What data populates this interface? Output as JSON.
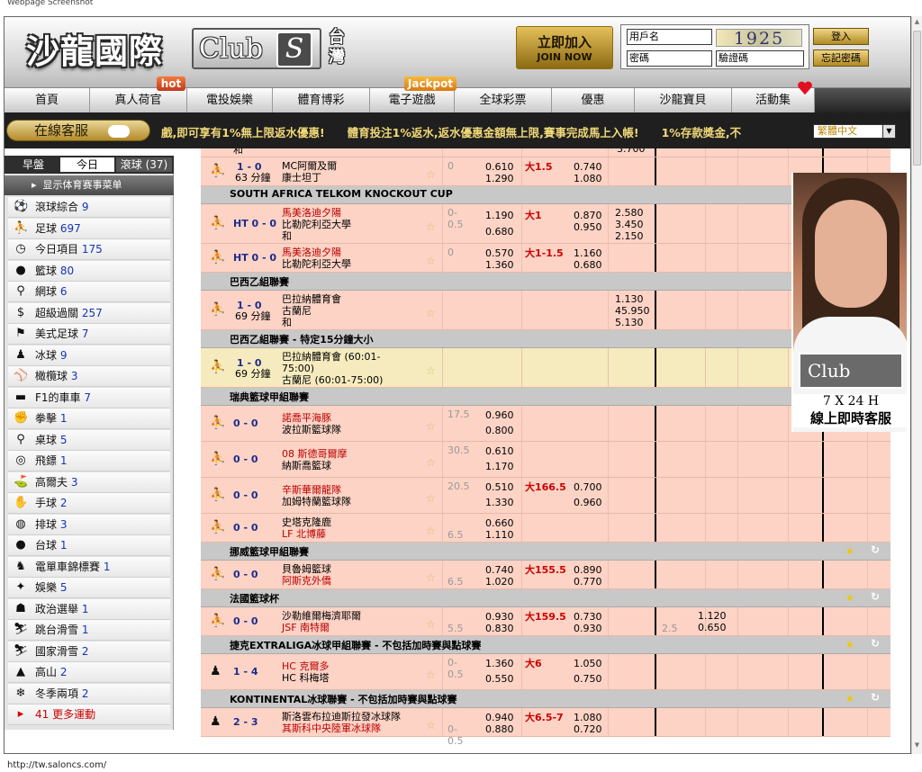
{
  "caption": "Webpage Screenshot",
  "status_url": "http://tw.saloncs.com/",
  "header": {
    "logo_text": "沙龍國際",
    "club_text": "Club",
    "club_s": "S",
    "region": "台灣",
    "join_cn": "立即加入",
    "join_en": "JOIN NOW",
    "username_placeholder": "用戶名",
    "password_placeholder": "密碼",
    "captcha_code": "1925",
    "captcha_placeholder": "驗證碼",
    "login_label": "登入",
    "forgot_label": "忘記密碼"
  },
  "badges": {
    "hot": "hot",
    "jackpot": "Jackpot"
  },
  "nav": [
    "首頁",
    "真人荷官",
    "電投娛樂",
    "體育博彩",
    "電子遊戲",
    "全球彩票",
    "優惠",
    "沙龍寶貝",
    "活動集"
  ],
  "marquee": {
    "service_label": "在線客服",
    "text": "戲,即可享有1%無上限返水優惠!　　體育投注1%返水,返水優惠金額無上限,賽事完成馬上入帳!　　1%存款獎金,不",
    "language": "繁體中文"
  },
  "sidebar": {
    "tabs": [
      "早盤",
      "今日",
      "滾球 (37)"
    ],
    "menu_header": "显示体育赛事菜单",
    "items": [
      {
        "icon": "soccer-ball-icon",
        "label": "滾球綜合",
        "count": "9"
      },
      {
        "icon": "soccer-player-icon",
        "label": "足球",
        "count": "697"
      },
      {
        "icon": "clock-icon",
        "label": "今日項目",
        "count": "175"
      },
      {
        "icon": "basketball-icon",
        "label": "籃球",
        "count": "80"
      },
      {
        "icon": "tennis-icon",
        "label": "網球",
        "count": "6"
      },
      {
        "icon": "parlay-icon",
        "label": "超級過關",
        "count": "257"
      },
      {
        "icon": "american-football-icon",
        "label": "美式足球",
        "count": "7"
      },
      {
        "icon": "ice-hockey-icon",
        "label": "冰球",
        "count": "9"
      },
      {
        "icon": "baseball-icon",
        "label": "橄欖球",
        "count": "3"
      },
      {
        "icon": "f1-car-icon",
        "label": "F1的車車",
        "count": "7"
      },
      {
        "icon": "boxing-icon",
        "label": "拳擊",
        "count": "1"
      },
      {
        "icon": "table-tennis-icon",
        "label": "桌球",
        "count": "5"
      },
      {
        "icon": "darts-icon",
        "label": "飛鏢",
        "count": "1"
      },
      {
        "icon": "golf-icon",
        "label": "高爾夫",
        "count": "3"
      },
      {
        "icon": "handball-icon",
        "label": "手球",
        "count": "2"
      },
      {
        "icon": "volleyball-icon",
        "label": "排球",
        "count": "3"
      },
      {
        "icon": "billiards-icon",
        "label": "台球",
        "count": "1"
      },
      {
        "icon": "motorbike-icon",
        "label": "電單車錦標賽",
        "count": "1"
      },
      {
        "icon": "entertainment-icon",
        "label": "娛樂",
        "count": "5"
      },
      {
        "icon": "politics-icon",
        "label": "政治選舉",
        "count": "1"
      },
      {
        "icon": "ski-jump-icon",
        "label": "跳台滑雪",
        "count": "1"
      },
      {
        "icon": "cross-country-ski-icon",
        "label": "國家滑雪",
        "count": "2"
      },
      {
        "icon": "mountain-icon",
        "label": "高山",
        "count": "2"
      },
      {
        "icon": "winter-sport-icon",
        "label": "冬季兩項",
        "count": "2"
      }
    ],
    "more": "41 更多運動"
  },
  "odds": {
    "top_partial": {
      "team": "和",
      "val": "3.700"
    },
    "rows": [
      {
        "type": "match",
        "sport": "soccer",
        "score": "1 - 0",
        "time": "63 分鐘",
        "teams": [
          "MC阿爾及爾",
          "康士坦丁"
        ],
        "red": [
          false,
          false
        ],
        "hc": "0",
        "hcodds": [
          "0.610",
          "1.290"
        ],
        "ou": "大1.5",
        "ouodds": [
          "0.740",
          "1.080"
        ],
        "x12": []
      },
      {
        "type": "section",
        "title": "SOUTH AFRICA TELKOM KNOCKOUT CUP"
      },
      {
        "type": "match",
        "sport": "soccer",
        "score": "HT 0 - 0",
        "time": "",
        "teams": [
          "馬美洛迪夕陽",
          "比勒陀利亞大學",
          "和"
        ],
        "red": [
          true,
          false,
          false
        ],
        "hc": "0-0.5",
        "hcodds": [
          "1.190",
          "0.680"
        ],
        "ou": "大1",
        "ouodds": [
          "0.870",
          "0.950"
        ],
        "x12": [
          "2.580",
          "3.450",
          "2.150"
        ]
      },
      {
        "type": "match",
        "sport": "soccer",
        "score": "HT 0 - 0",
        "time": "",
        "teams": [
          "馬美洛迪夕陽",
          "比勒陀利亞大學"
        ],
        "red": [
          true,
          false
        ],
        "hc": "0",
        "hcodds": [
          "0.570",
          "1.360"
        ],
        "ou": "大1-1.5",
        "ouodds": [
          "1.160",
          "0.680"
        ],
        "x12": []
      },
      {
        "type": "section",
        "title": "巴西乙組聯賽"
      },
      {
        "type": "match",
        "sport": "soccer",
        "score": "1 - 0",
        "time": "69 分鐘",
        "teams": [
          "巴拉納體育會",
          "古蘭尼",
          "和"
        ],
        "red": [
          false,
          false,
          false
        ],
        "hc": "",
        "hcodds": [],
        "ou": "",
        "ouodds": [],
        "x12": [
          "1.130",
          "45.950",
          "5.130"
        ]
      },
      {
        "type": "section",
        "title": "巴西乙組聯賽 - 特定15分鐘大小"
      },
      {
        "type": "match",
        "yellow": true,
        "sport": "soccer",
        "score": "1 - 0",
        "time": "69 分鐘",
        "teams": [
          "巴拉納體育會 (60:01-",
          "75:00)",
          "古蘭尼 (60:01-75:00)"
        ],
        "red": [
          false,
          false,
          false
        ],
        "hc": "",
        "hcodds": [],
        "ou": "",
        "ouodds": [],
        "x12": []
      },
      {
        "type": "section",
        "title": "瑞典籃球甲組聯賽",
        "icons": true
      },
      {
        "type": "match",
        "sport": "basketball",
        "score": "0 - 0",
        "time": "",
        "teams": [
          "諾喬平海豚",
          "波拉斯籃球隊"
        ],
        "red": [
          true,
          false
        ],
        "hc": "17.5",
        "hcodds": [
          "0.960",
          "0.800"
        ],
        "ou": "",
        "ouodds": [],
        "x12": []
      },
      {
        "type": "match",
        "sport": "basketball",
        "score": "0 - 0",
        "time": "",
        "teams": [
          "08 斯德哥爾摩",
          "納斯喬籃球"
        ],
        "red": [
          true,
          false
        ],
        "hc": "30.5",
        "hcodds": [
          "0.610",
          "1.170"
        ],
        "ou": "",
        "ouodds": [],
        "x12": []
      },
      {
        "type": "match",
        "sport": "basketball",
        "score": "0 - 0",
        "time": "",
        "teams": [
          "辛斯華爾龍隊",
          "加姆特蘭籃球隊"
        ],
        "red": [
          true,
          false
        ],
        "hc": "20.5",
        "hcodds": [
          "0.510",
          "1.330"
        ],
        "ou": "大166.5",
        "ouodds": [
          "0.700",
          "0.960"
        ],
        "x12": []
      },
      {
        "type": "match",
        "sport": "basketball",
        "score": "0 - 0",
        "time": "",
        "teams": [
          "史塔克隆鹿",
          "LF 北博藤"
        ],
        "red": [
          false,
          true
        ],
        "hc": "6.5",
        "hclow": true,
        "hcodds": [
          "0.660",
          "1.110"
        ],
        "ou": "",
        "ouodds": [],
        "x12": []
      },
      {
        "type": "section",
        "title": "挪威籃球甲組聯賽",
        "icons": true
      },
      {
        "type": "match",
        "sport": "basketball",
        "score": "0 - 0",
        "time": "",
        "teams": [
          "貝魯姆籃球",
          "阿斯克外僑"
        ],
        "red": [
          false,
          true
        ],
        "hc": "6.5",
        "hclow": true,
        "hcodds": [
          "0.740",
          "1.020"
        ],
        "ou": "大155.5",
        "ouodds": [
          "0.890",
          "0.770"
        ],
        "x12": []
      },
      {
        "type": "section",
        "title": "法國籃球杯",
        "icons": true
      },
      {
        "type": "match",
        "sport": "basketball",
        "score": "0 - 0",
        "time": "",
        "teams": [
          "沙勒維爾梅濟耶爾",
          "JSF 南特爾"
        ],
        "red": [
          false,
          true
        ],
        "hc": "5.5",
        "hclow": true,
        "hcodds": [
          "0.930",
          "0.830"
        ],
        "ou": "大159.5",
        "ouodds": [
          "0.730",
          "0.930"
        ],
        "x12": [],
        "extra": {
          "hc": "2.5",
          "odds": [
            "1.120",
            "0.650"
          ]
        }
      },
      {
        "type": "section",
        "title": "捷克EXTRALIGA冰球甲組聯賽 - 不包括加時賽與點球賽",
        "icons": true
      },
      {
        "type": "match",
        "sport": "hockey",
        "score": "1 - 4",
        "time": "",
        "teams": [
          "HC 克爾多",
          "HC 科梅塔"
        ],
        "red": [
          true,
          false
        ],
        "hc": "0-0.5",
        "hcodds": [
          "1.360",
          "0.550"
        ],
        "ou": "大6",
        "ouodds": [
          "1.050",
          "0.750"
        ],
        "x12": []
      },
      {
        "type": "section",
        "title": "KONTINENTAL冰球聯賽 - 不包括加時賽與點球賽",
        "icons": true
      },
      {
        "type": "match",
        "sport": "hockey",
        "score": "2 - 3",
        "time": "",
        "teams": [
          "斯洛雲布拉迪斯拉發冰球隊",
          "其斯科中央陸軍冰球隊"
        ],
        "red": [
          false,
          true
        ],
        "hc": "0-0.5",
        "hclow": true,
        "hcodds": [
          "0.940",
          "0.880"
        ],
        "ou": "大6.5-7",
        "ouodds": [
          "1.080",
          "0.720"
        ],
        "x12": []
      }
    ]
  },
  "ad": {
    "club": "Club",
    "hours": "7 X 24 H",
    "service": "線上即時客服"
  },
  "colors": {
    "row_pink": "#fcd3c5",
    "row_yellow": "#f5ebbe",
    "section_gray": "#c8c8c8",
    "accent_gold": "#e5c05a",
    "count_blue": "#1535b3"
  }
}
